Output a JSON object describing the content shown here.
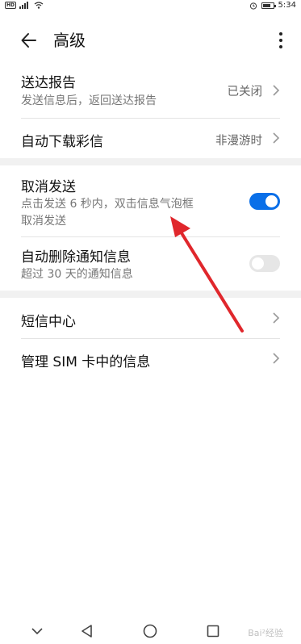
{
  "status_bar": {
    "network_badge": "HD",
    "signal": "⁴ᴳ",
    "time": "5:34"
  },
  "header": {
    "title": "高级"
  },
  "items": [
    {
      "label": "送达报告",
      "subtitle": "发送信息后，返回送达报告",
      "value": "已关闭"
    },
    {
      "label": "自动下载彩信",
      "value": "非漫游时"
    },
    {
      "label": "取消发送",
      "subtitle_line1": "点击发送 6 秒内，双击信息气泡框",
      "subtitle_line2": "取消发送",
      "toggle": "on"
    },
    {
      "label": "自动删除通知信息",
      "subtitle": "超过 30 天的通知信息",
      "toggle": "off"
    },
    {
      "label": "短信中心"
    },
    {
      "label": "管理 SIM 卡中的信息"
    }
  ],
  "colors": {
    "accent": "#0a6fe8",
    "annotation_arrow": "#e0272c"
  },
  "watermark": "Bai²经验"
}
